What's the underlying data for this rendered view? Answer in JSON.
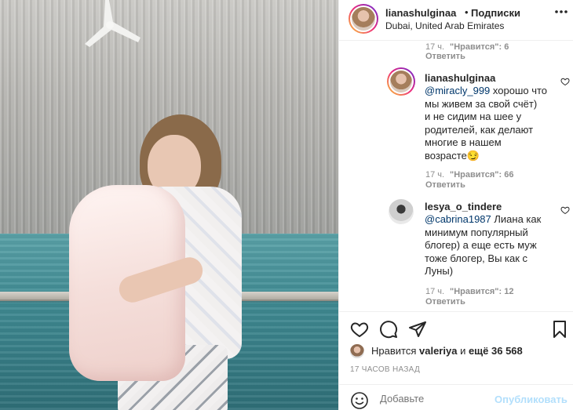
{
  "post": {
    "username": "lianashulginaa",
    "separator": "•",
    "follow_label": "Подписки",
    "location": "Dubai, United Arab Emirates",
    "more_icon": "more-horizontal-icon"
  },
  "comments": [
    {
      "time": "17 ч.",
      "likes_label": "\"Нравится\": 6",
      "reply_label": "Ответить"
    },
    {
      "username": "lianashulginaa",
      "mention": "@miracly_999",
      "text_lines": [
        "хорошо что",
        "мы живем за свой счёт)",
        "и не сидим на шее у",
        "родителей, как делают",
        "многие в нашем",
        "возрасте😏"
      ],
      "time": "17 ч.",
      "likes_label": "\"Нравится\": 66",
      "reply_label": "Ответить"
    },
    {
      "username": "lesya_o_tindere",
      "mention": "@cabrina1987",
      "text_lines": [
        "Лиана как",
        "минимум популярный",
        "блогер) а еще есть муж",
        "тоже блогер, Вы как с",
        "Луны)"
      ],
      "time": "17 ч.",
      "likes_label": "\"Нравится\": 12",
      "reply_label": "Ответить"
    }
  ],
  "likes": {
    "prefix": "Нравится",
    "user": "valeriya",
    "suffix_conj": "и",
    "others": "ещё 36 568"
  },
  "time_ago": "17 ЧАСОВ НАЗАД",
  "add_comment": {
    "placeholder": "Добавьте",
    "publish_label": "Опубликовать"
  },
  "colors": {
    "text": "#262626",
    "secondary": "#8e8e8e",
    "link": "#00376b",
    "publish_disabled": "#b2dffc",
    "border": "#efefef"
  }
}
